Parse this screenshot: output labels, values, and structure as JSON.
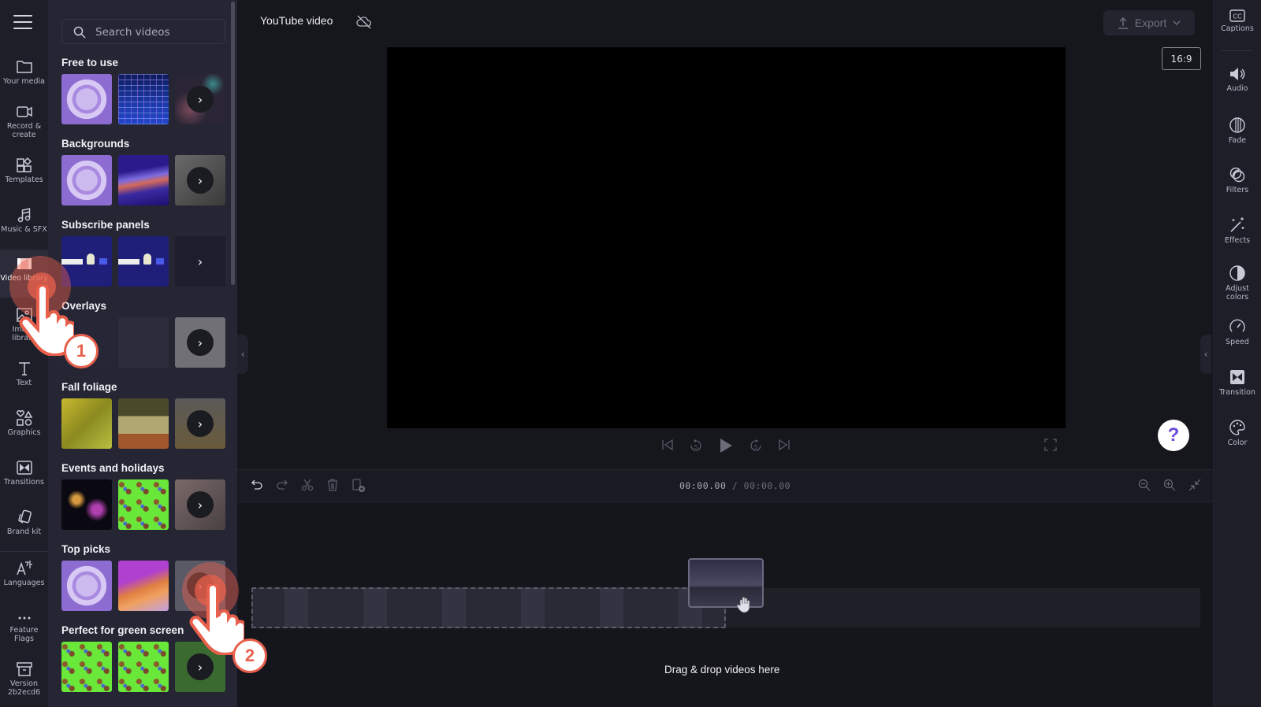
{
  "nav": {
    "items": [
      {
        "label": "Your media",
        "icon": "folder-icon"
      },
      {
        "label": "Record &\ncreate",
        "icon": "video-camera-icon"
      },
      {
        "label": "Templates",
        "icon": "templates-icon"
      },
      {
        "label": "Music & SFX",
        "icon": "music-note-icon"
      },
      {
        "label": "Video library",
        "icon": "film-icon",
        "active": true
      },
      {
        "label": "Image\nlibrary",
        "icon": "image-icon"
      },
      {
        "label": "Text",
        "icon": "text-icon"
      },
      {
        "label": "Graphics",
        "icon": "shapes-icon"
      },
      {
        "label": "Transitions",
        "icon": "transition-icon"
      },
      {
        "label": "Brand kit",
        "icon": "brand-kit-icon"
      },
      {
        "label": "Languages",
        "icon": "language-icon"
      },
      {
        "label": "Feature\nFlags",
        "icon": "more-dots-icon"
      },
      {
        "label": "Version\n2b2ecd6",
        "icon": "archive-icon"
      }
    ]
  },
  "library": {
    "search_placeholder": "Search videos",
    "sections": [
      {
        "title": "Free to use"
      },
      {
        "title": "Backgrounds"
      },
      {
        "title": "Subscribe panels"
      },
      {
        "title": "Overlays"
      },
      {
        "title": "Fall foliage"
      },
      {
        "title": "Events and holidays"
      },
      {
        "title": "Top picks"
      },
      {
        "title": "Perfect for green screen"
      }
    ],
    "more_glyph": "›"
  },
  "header": {
    "project_title": "YouTube video",
    "export_label": "Export",
    "aspect_ratio": "16:9"
  },
  "playback": {
    "current_time": "00:00.00",
    "separator": " / ",
    "total_time": "00:00.00"
  },
  "timeline": {
    "drop_hint": "Drag & drop videos here"
  },
  "right_rail": {
    "items": [
      {
        "label": "Captions",
        "icon": "captions-icon"
      },
      {
        "label": "Audio",
        "icon": "speaker-icon"
      },
      {
        "label": "Fade",
        "icon": "fade-icon"
      },
      {
        "label": "Filters",
        "icon": "filters-icon"
      },
      {
        "label": "Effects",
        "icon": "magic-wand-icon"
      },
      {
        "label": "Adjust\ncolors",
        "icon": "contrast-icon"
      },
      {
        "label": "Speed",
        "icon": "speedometer-icon"
      },
      {
        "label": "Transition",
        "icon": "transition-icon"
      },
      {
        "label": "Color",
        "icon": "palette-icon"
      }
    ]
  },
  "help": {
    "glyph": "?"
  },
  "tutorial": {
    "step1": "1",
    "step2": "2",
    "accent": "#e8604c"
  }
}
